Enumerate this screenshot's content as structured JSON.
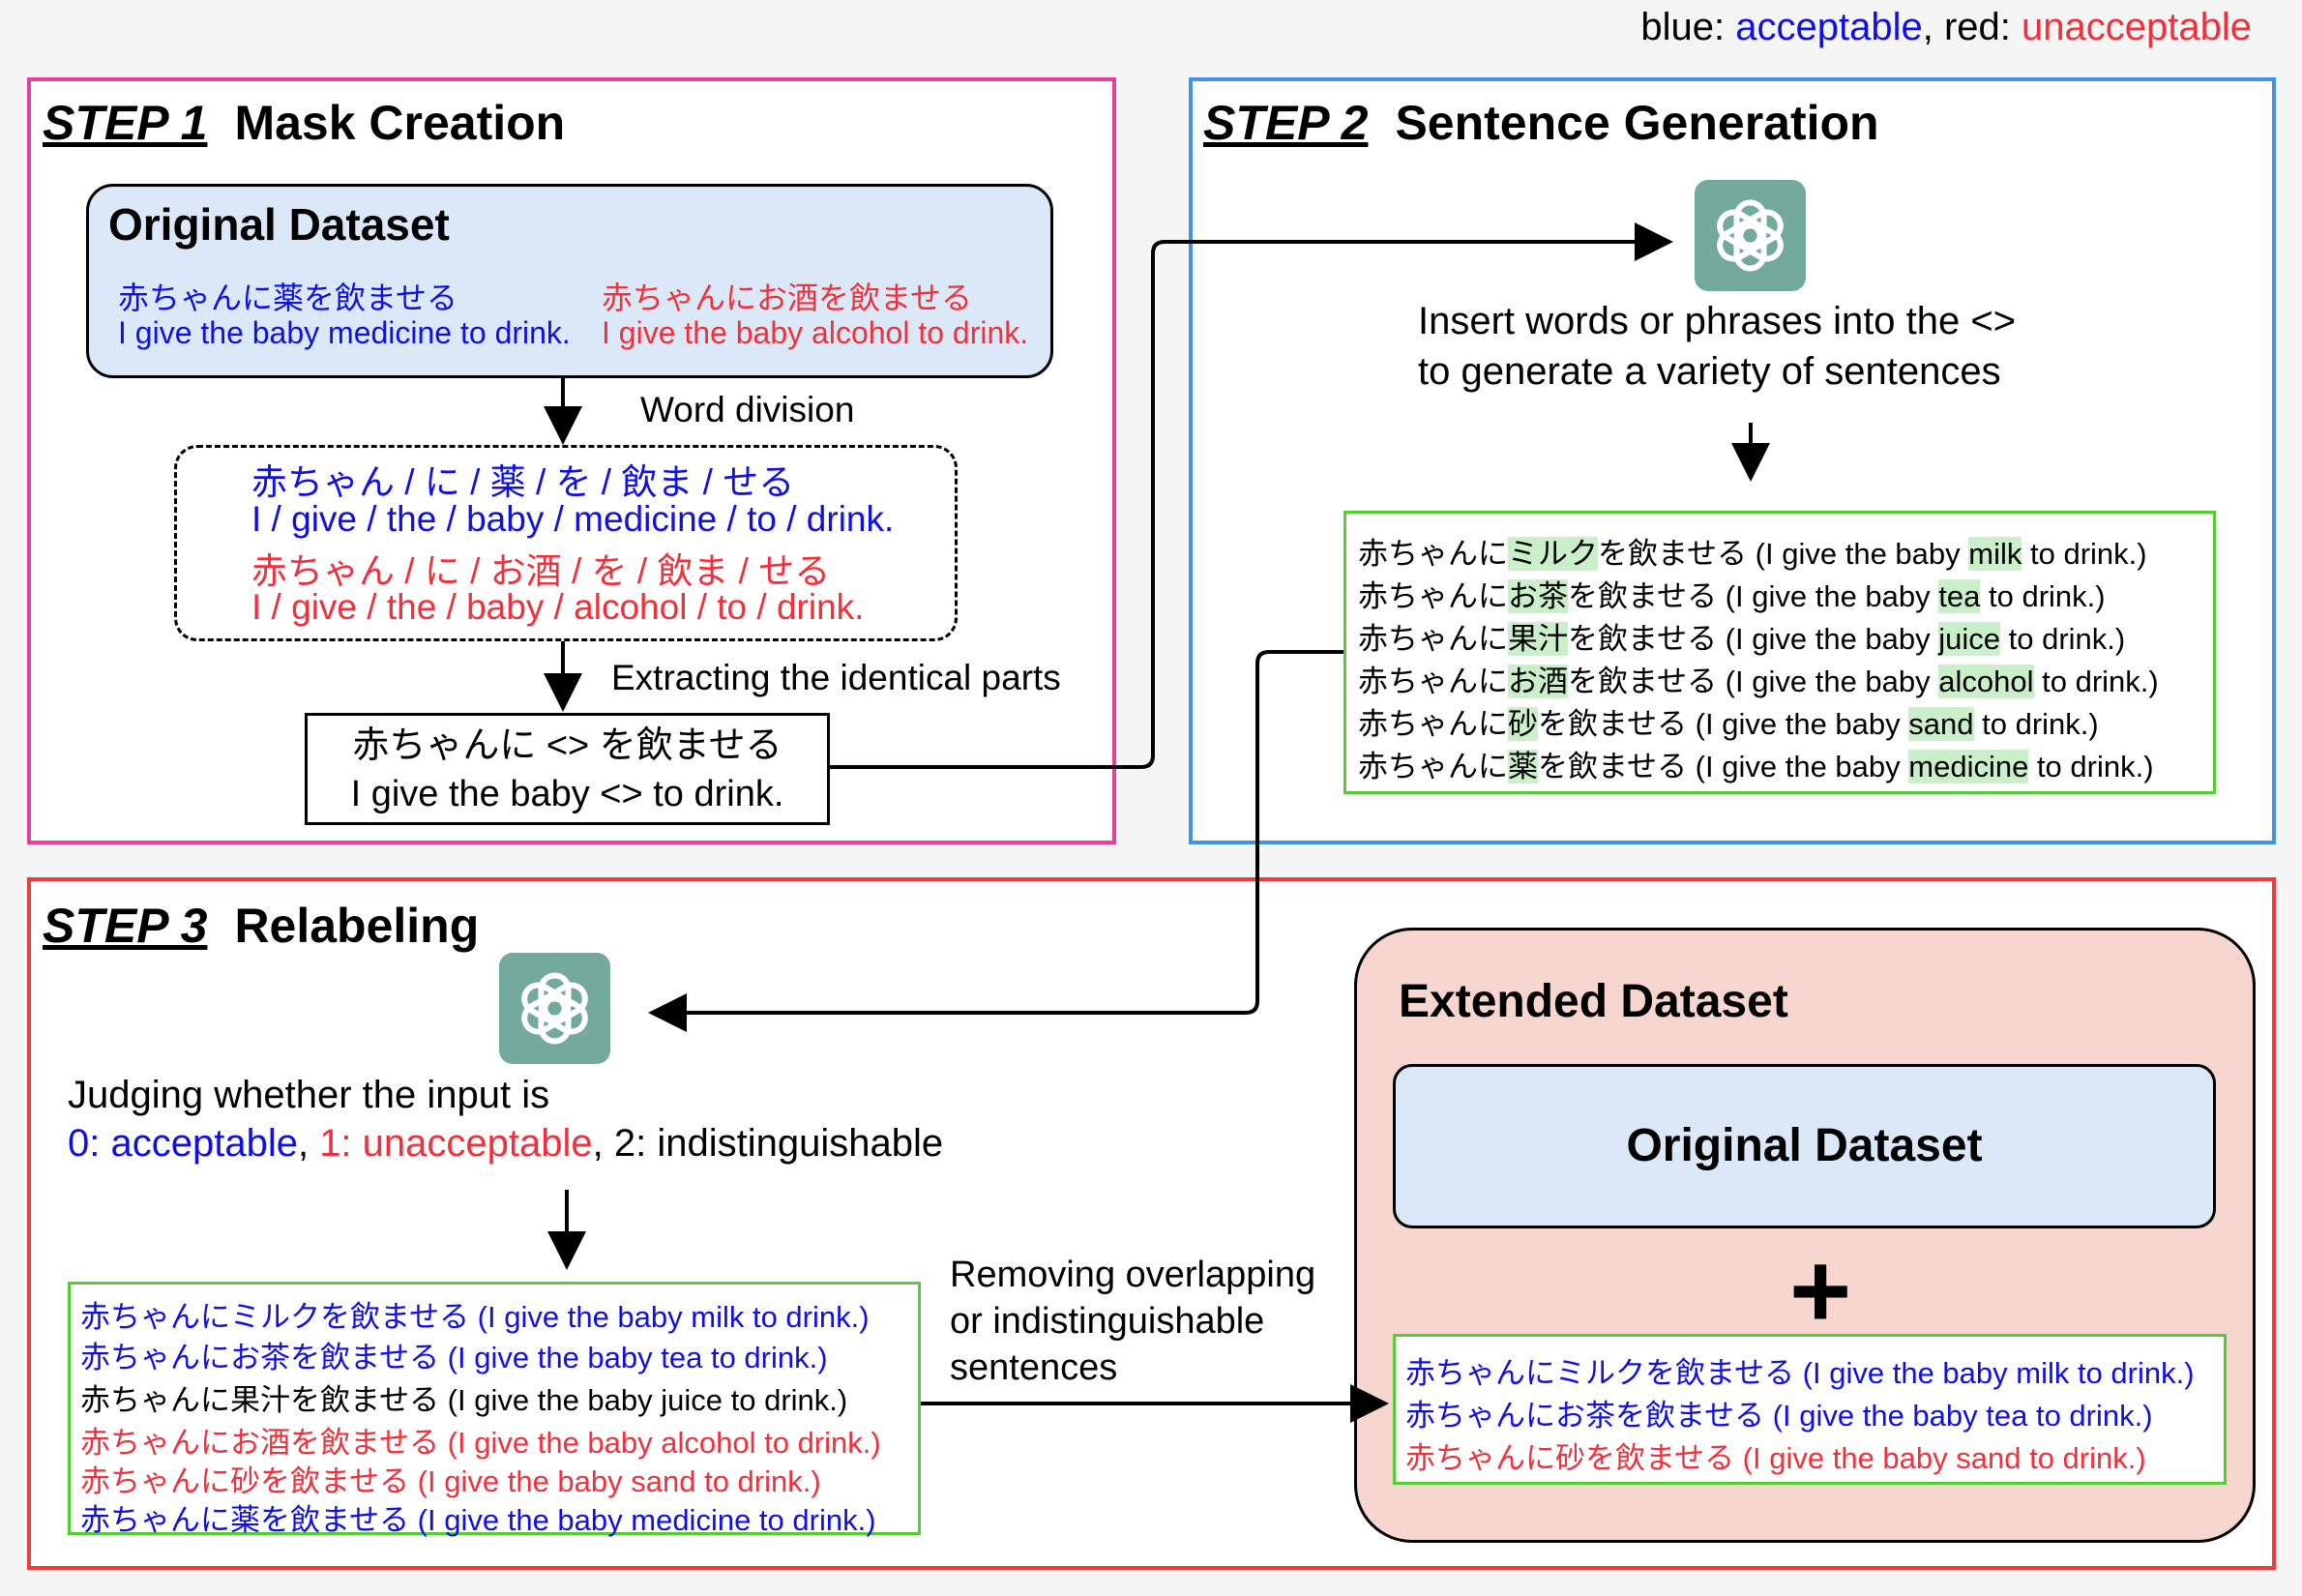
{
  "legend": {
    "blue_label": "blue:",
    "acceptable": "acceptable",
    "sep": ",",
    "red_label": "red:",
    "unacceptable": "unacceptable"
  },
  "colors": {
    "acceptable": "#1010e0",
    "unacceptable": "#f0303a",
    "step1_border": "#e8409a",
    "step2_border": "#3f94e8",
    "step3_border": "#ee3c3c",
    "highlight": "#c9f0c9",
    "gpt_icon": "#74aa9c"
  },
  "step1": {
    "num": "STEP 1",
    "title": "Mask Creation",
    "original_title": "Original Dataset",
    "ex_good_jp": "赤ちゃんに薬を飲ませる",
    "ex_good_en": "I give the baby medicine to drink.",
    "ex_bad_jp": "赤ちゃんにお酒を飲ませる",
    "ex_bad_en": "I give the baby alcohol to drink.",
    "word_division": "Word division",
    "split_good_jp": "赤ちゃん / に / 薬 / を / 飲ま / せる",
    "split_good_en": "I / give / the / baby / medicine / to / drink.",
    "split_bad_jp": "赤ちゃん / に / お酒 / を / 飲ま / せる",
    "split_bad_en": "I / give / the / baby / alcohol / to / drink.",
    "extracting": "Extracting the identical parts",
    "mask_jp": "赤ちゃんに <> を飲ませる",
    "mask_en": "I give the baby <> to drink."
  },
  "step2": {
    "num": "STEP 2",
    "title": "Sentence Generation",
    "instruction_line1": "Insert words or phrases into the <>",
    "instruction_line2": "to generate a variety of sentences",
    "generated": [
      {
        "pre": "赤ちゃんに",
        "word": "ミルク",
        "mid": "を飲ませる (I give the baby ",
        "en_word": "milk",
        "post": " to drink.)"
      },
      {
        "pre": "赤ちゃんに",
        "word": "お茶",
        "mid": "を飲ませる (I give the baby ",
        "en_word": "tea",
        "post": " to drink.)"
      },
      {
        "pre": "赤ちゃんに",
        "word": "果汁",
        "mid": "を飲ませる (I give the baby ",
        "en_word": "juice",
        "post": " to drink.)"
      },
      {
        "pre": "赤ちゃんに",
        "word": "お酒",
        "mid": "を飲ませる (I give the baby ",
        "en_word": "alcohol",
        "post": " to drink.)"
      },
      {
        "pre": "赤ちゃんに",
        "word": "砂",
        "mid": "を飲ませる (I give the baby ",
        "en_word": "sand",
        "post": " to drink.)"
      },
      {
        "pre": "赤ちゃんに",
        "word": "薬",
        "mid": "を飲ませる (I give the baby ",
        "en_word": "medicine",
        "post": " to drink.)"
      }
    ]
  },
  "step3": {
    "num": "STEP 3",
    "title": "Relabeling",
    "judging_line1": "Judging whether the input is",
    "label0": "0: acceptable",
    "comma1": ", ",
    "label1": "1: unacceptable",
    "label2": ", 2: indistinguishable",
    "relabeled": [
      {
        "text": "赤ちゃんにミルクを飲ませる (I give the baby milk to drink.)",
        "label": "acceptable"
      },
      {
        "text": "赤ちゃんにお茶を飲ませる (I give the baby tea to drink.)",
        "label": "acceptable"
      },
      {
        "text": "赤ちゃんに果汁を飲ませる (I give the baby juice to drink.)",
        "label": "indistinguishable"
      },
      {
        "text": "赤ちゃんにお酒を飲ませる (I give the baby alcohol to drink.)",
        "label": "unacceptable"
      },
      {
        "text": "赤ちゃんに砂を飲ませる (I give the baby sand to drink.)",
        "label": "unacceptable"
      },
      {
        "text": "赤ちゃんに薬を飲ませる (I give the baby medicine to drink.)",
        "label": "acceptable"
      }
    ],
    "removing_line1": "Removing overlapping",
    "removing_line2": "or indistinguishable",
    "removing_line3": "sentences",
    "extended_title": "Extended Dataset",
    "original_title": "Original Dataset",
    "plus": "+",
    "final": [
      {
        "text": "赤ちゃんにミルクを飲ませる (I give the baby milk to drink.)",
        "label": "acceptable"
      },
      {
        "text": "赤ちゃんにお茶を飲ませる (I give the baby tea to drink.)",
        "label": "acceptable"
      },
      {
        "text": "赤ちゃんに砂を飲ませる (I give the baby sand to drink.)",
        "label": "unacceptable"
      }
    ]
  },
  "icons": {
    "gpt_step2": "chatgpt-icon",
    "gpt_step3": "chatgpt-icon"
  }
}
